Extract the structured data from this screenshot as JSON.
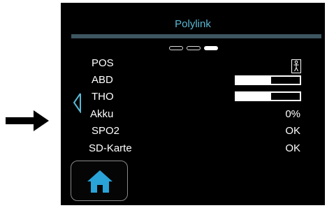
{
  "colors": {
    "accent": "#5ab8d4",
    "title_bar": "#3d5660",
    "home_icon": "#2aa3d8",
    "screen_background": "#000000",
    "text": "#ffffff"
  },
  "header": {
    "title": "Polylink"
  },
  "pagination": {
    "pages": 3,
    "active_page": 3
  },
  "rows": {
    "pos": {
      "label": "POS",
      "icon": "body-position-standing-icon"
    },
    "abd": {
      "label": "ABD",
      "level": 0.55
    },
    "tho": {
      "label": "THO",
      "level": 0.55
    },
    "akku": {
      "label": "Akku",
      "value": "0%"
    },
    "spo2": {
      "label": "SPO2",
      "value": "OK"
    },
    "sdkarte": {
      "label": "SD-Karte",
      "value": "OK"
    }
  },
  "navigation": {
    "left_icon": "chevron-left-icon",
    "home_icon": "home-icon"
  },
  "annotation": {
    "icon": "pointer-arrow-icon"
  }
}
